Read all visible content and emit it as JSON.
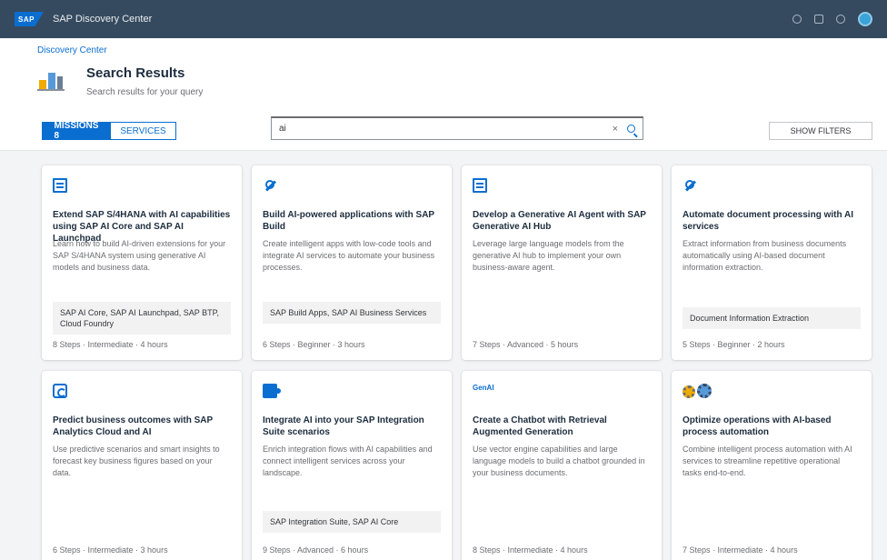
{
  "shell": {
    "logo": "SAP",
    "title": "SAP Discovery Center",
    "icons": [
      "search-icon",
      "notification-icon",
      "help-icon",
      "user-avatar"
    ]
  },
  "header": {
    "breadcrumb": "Discovery Center",
    "title": "Search Results",
    "subtitle": "Search results for your query",
    "tabs": [
      {
        "label": "MISSIONS 8",
        "active": true
      },
      {
        "label": "SERVICES",
        "active": false
      }
    ],
    "search": {
      "value": "ai",
      "placeholder": "Search"
    },
    "filter_label": "SHOW FILTERS"
  },
  "cards": [
    {
      "icon": "document-icon",
      "title": "Extend SAP S/4HANA with AI capabilities using SAP AI Core and SAP AI Launchpad",
      "description": "Learn how to build AI-driven extensions for your SAP S/4HANA system using generative AI models and business data.",
      "tag": "SAP AI Core, SAP AI Launchpad, SAP BTP, Cloud Foundry",
      "footer": "8 Steps · Intermediate · 4 hours"
    },
    {
      "icon": "tool-icon",
      "title": "Build AI-powered applications with SAP Build",
      "description": "Create intelligent apps with low-code tools and integrate AI services to automate your business processes.",
      "tag": "SAP Build Apps, SAP AI Business Services",
      "footer": "6 Steps · Beginner · 3 hours"
    },
    {
      "icon": "document-icon",
      "title": "Develop a Generative AI Agent with SAP Generative AI Hub",
      "description": "Leverage large language models from the generative AI hub to implement your own business-aware agent.",
      "tag": "",
      "footer": "7 Steps · Advanced · 5 hours"
    },
    {
      "icon": "tool-icon",
      "title": "Automate document processing with AI services",
      "description": "Extract information from business documents automatically using AI-based document information extraction.",
      "tag": "Document Information Extraction",
      "footer": "5 Steps · Beginner · 2 hours"
    },
    {
      "icon": "calculator-icon",
      "title": "Predict business outcomes with SAP Analytics Cloud and AI",
      "description": "Use predictive scenarios and smart insights to forecast key business figures based on your data.",
      "tag": "",
      "footer": "6 Steps · Intermediate · 3 hours"
    },
    {
      "icon": "puzzle-icon",
      "title": "Integrate AI into your SAP Integration Suite scenarios",
      "description": "Enrich integration flows with AI capabilities and connect intelligent services across your landscape.",
      "tag": "SAP Integration Suite, SAP AI Core",
      "footer": "9 Steps · Advanced · 6 hours"
    },
    {
      "icon": "text-logo-icon",
      "icon_text": "GenAI",
      "title": "Create a Chatbot with Retrieval Augmented Generation",
      "description": "Use vector engine capabilities and large language models to build a chatbot grounded in your business documents.",
      "tag": "",
      "footer": "8 Steps · Intermediate · 4 hours"
    },
    {
      "icon": "gears-icon",
      "title": "Optimize operations with AI-based process automation",
      "description": "Combine intelligent process automation with AI services to streamline repetitive operational tasks end-to-end.",
      "tag": "",
      "footer": "7 Steps · Intermediate · 4 hours"
    }
  ]
}
